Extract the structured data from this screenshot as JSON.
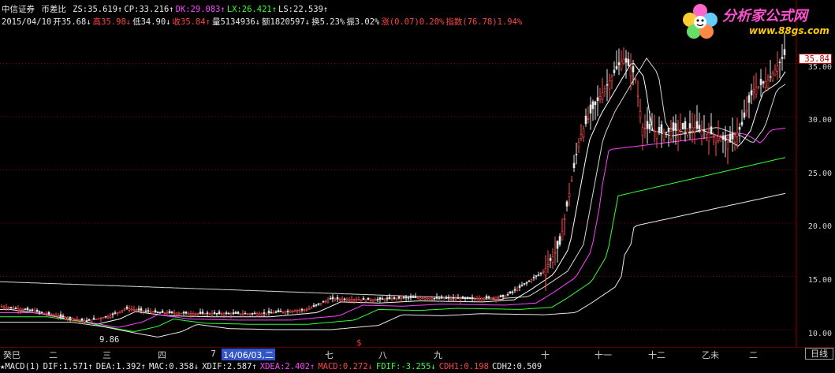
{
  "header": {
    "stock_name": "中信证券",
    "indicator": "币差比",
    "line1": [
      {
        "label": "ZS:",
        "value": "35.619",
        "arrow": "↑",
        "color": "#e8e8e8"
      },
      {
        "label": "CP:",
        "value": "33.216",
        "arrow": "↑",
        "color": "#e8e8e8"
      },
      {
        "label": "DK:",
        "value": "29.083",
        "arrow": "↑",
        "color": "#ff44ff"
      },
      {
        "label": "LX:",
        "value": "26.421",
        "arrow": "↑",
        "color": "#33ff33"
      },
      {
        "label": "LS:",
        "value": "22.539",
        "arrow": "↑",
        "color": "#e8e8e8"
      }
    ],
    "line2": [
      {
        "label": "2015/04/10",
        "value": "",
        "arrow": "",
        "color": "#e8e8e8"
      },
      {
        "label": "开",
        "value": "35.68",
        "arrow": "↓",
        "color": "#e8e8e8"
      },
      {
        "label": "高",
        "value": "35.98",
        "arrow": "↓",
        "color": "#ff4444"
      },
      {
        "label": "低",
        "value": "34.90",
        "arrow": "↓",
        "color": "#e8e8e8"
      },
      {
        "label": "收",
        "value": "35.84",
        "arrow": "↑",
        "color": "#ff4444"
      },
      {
        "label": "量",
        "value": "5134936",
        "arrow": "↓",
        "color": "#e8e8e8"
      },
      {
        "label": "额",
        "value": "1820597",
        "arrow": "↓",
        "color": "#e8e8e8"
      },
      {
        "label": "换",
        "value": "5.23%",
        "arrow": "",
        "color": "#e8e8e8"
      },
      {
        "label": "振",
        "value": "3.02%",
        "arrow": "",
        "color": "#e8e8e8"
      },
      {
        "label": "涨",
        "value": "(0.07)0.20%",
        "arrow": "",
        "color": "#ff4444"
      },
      {
        "label": "指数",
        "value": "(76.78)1.94%",
        "arrow": "",
        "color": "#ff4444"
      }
    ]
  },
  "logo": {
    "title": "分析家公式网",
    "url": "www.88gs.com"
  },
  "price_axis": {
    "ticks": [
      "35.00",
      "30.00",
      "25.00",
      "20.00",
      "15.00",
      "10.00"
    ],
    "current_price": "35.84",
    "low_label": "9.86"
  },
  "x_axis": {
    "labels": [
      "癸巳",
      "二",
      "三",
      "四",
      "7",
      "14/06/03,二",
      "七",
      "八",
      "九",
      "十",
      "十一",
      "十二",
      "乙未",
      "二"
    ],
    "period_button": "日线",
    "marker": "$"
  },
  "macd_row": {
    "items": [
      {
        "text": "★MACD(1)",
        "color": "#e8e8e8"
      },
      {
        "text": "DIF:1.571↑",
        "color": "#e8e8e8"
      },
      {
        "text": "DEA:1.392↑",
        "color": "#e8e8e8"
      },
      {
        "text": "MAC:0.358↓",
        "color": "#e8e8e8"
      },
      {
        "text": "XDIF:2.587↑",
        "color": "#e8e8e8"
      },
      {
        "text": "XDEA:2.402↑",
        "color": "#ff44ff"
      },
      {
        "text": "MACD:0.272↓",
        "color": "#ff4444"
      },
      {
        "text": "FDIF:-3.255↓",
        "color": "#33ff33"
      },
      {
        "text": "CDH1:0.198",
        "color": "#ff4444"
      },
      {
        "text": "CDH2:0.509",
        "color": "#e8e8e8"
      }
    ]
  },
  "colors": {
    "background": "#000000",
    "grid": "#8b0000",
    "bull_candle": "#ff5050",
    "bear_candle": "#e8e8e8",
    "zs_line": "#ffffff",
    "dk_line": "#ff44ff",
    "lx_line": "#33ff33",
    "ls_line": "#e8e8e8"
  }
}
